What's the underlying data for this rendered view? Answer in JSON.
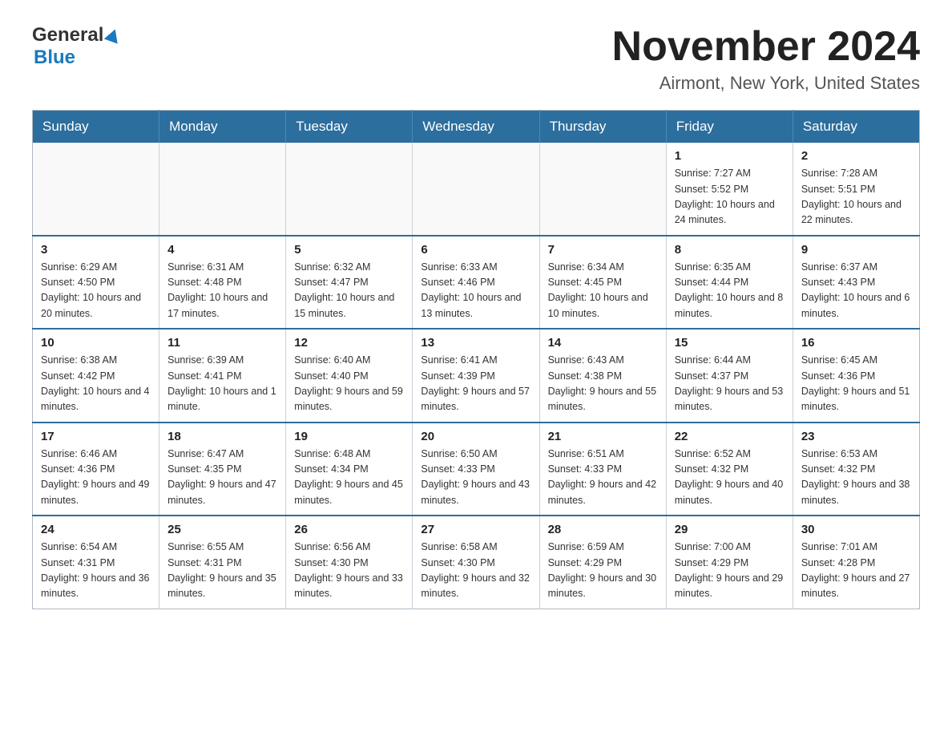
{
  "header": {
    "logo_line1": "General",
    "logo_line2": "Blue",
    "month_title": "November 2024",
    "location": "Airmont, New York, United States"
  },
  "days_of_week": [
    "Sunday",
    "Monday",
    "Tuesday",
    "Wednesday",
    "Thursday",
    "Friday",
    "Saturday"
  ],
  "weeks": [
    [
      {
        "day": "",
        "info": ""
      },
      {
        "day": "",
        "info": ""
      },
      {
        "day": "",
        "info": ""
      },
      {
        "day": "",
        "info": ""
      },
      {
        "day": "",
        "info": ""
      },
      {
        "day": "1",
        "info": "Sunrise: 7:27 AM\nSunset: 5:52 PM\nDaylight: 10 hours and 24 minutes."
      },
      {
        "day": "2",
        "info": "Sunrise: 7:28 AM\nSunset: 5:51 PM\nDaylight: 10 hours and 22 minutes."
      }
    ],
    [
      {
        "day": "3",
        "info": "Sunrise: 6:29 AM\nSunset: 4:50 PM\nDaylight: 10 hours and 20 minutes."
      },
      {
        "day": "4",
        "info": "Sunrise: 6:31 AM\nSunset: 4:48 PM\nDaylight: 10 hours and 17 minutes."
      },
      {
        "day": "5",
        "info": "Sunrise: 6:32 AM\nSunset: 4:47 PM\nDaylight: 10 hours and 15 minutes."
      },
      {
        "day": "6",
        "info": "Sunrise: 6:33 AM\nSunset: 4:46 PM\nDaylight: 10 hours and 13 minutes."
      },
      {
        "day": "7",
        "info": "Sunrise: 6:34 AM\nSunset: 4:45 PM\nDaylight: 10 hours and 10 minutes."
      },
      {
        "day": "8",
        "info": "Sunrise: 6:35 AM\nSunset: 4:44 PM\nDaylight: 10 hours and 8 minutes."
      },
      {
        "day": "9",
        "info": "Sunrise: 6:37 AM\nSunset: 4:43 PM\nDaylight: 10 hours and 6 minutes."
      }
    ],
    [
      {
        "day": "10",
        "info": "Sunrise: 6:38 AM\nSunset: 4:42 PM\nDaylight: 10 hours and 4 minutes."
      },
      {
        "day": "11",
        "info": "Sunrise: 6:39 AM\nSunset: 4:41 PM\nDaylight: 10 hours and 1 minute."
      },
      {
        "day": "12",
        "info": "Sunrise: 6:40 AM\nSunset: 4:40 PM\nDaylight: 9 hours and 59 minutes."
      },
      {
        "day": "13",
        "info": "Sunrise: 6:41 AM\nSunset: 4:39 PM\nDaylight: 9 hours and 57 minutes."
      },
      {
        "day": "14",
        "info": "Sunrise: 6:43 AM\nSunset: 4:38 PM\nDaylight: 9 hours and 55 minutes."
      },
      {
        "day": "15",
        "info": "Sunrise: 6:44 AM\nSunset: 4:37 PM\nDaylight: 9 hours and 53 minutes."
      },
      {
        "day": "16",
        "info": "Sunrise: 6:45 AM\nSunset: 4:36 PM\nDaylight: 9 hours and 51 minutes."
      }
    ],
    [
      {
        "day": "17",
        "info": "Sunrise: 6:46 AM\nSunset: 4:36 PM\nDaylight: 9 hours and 49 minutes."
      },
      {
        "day": "18",
        "info": "Sunrise: 6:47 AM\nSunset: 4:35 PM\nDaylight: 9 hours and 47 minutes."
      },
      {
        "day": "19",
        "info": "Sunrise: 6:48 AM\nSunset: 4:34 PM\nDaylight: 9 hours and 45 minutes."
      },
      {
        "day": "20",
        "info": "Sunrise: 6:50 AM\nSunset: 4:33 PM\nDaylight: 9 hours and 43 minutes."
      },
      {
        "day": "21",
        "info": "Sunrise: 6:51 AM\nSunset: 4:33 PM\nDaylight: 9 hours and 42 minutes."
      },
      {
        "day": "22",
        "info": "Sunrise: 6:52 AM\nSunset: 4:32 PM\nDaylight: 9 hours and 40 minutes."
      },
      {
        "day": "23",
        "info": "Sunrise: 6:53 AM\nSunset: 4:32 PM\nDaylight: 9 hours and 38 minutes."
      }
    ],
    [
      {
        "day": "24",
        "info": "Sunrise: 6:54 AM\nSunset: 4:31 PM\nDaylight: 9 hours and 36 minutes."
      },
      {
        "day": "25",
        "info": "Sunrise: 6:55 AM\nSunset: 4:31 PM\nDaylight: 9 hours and 35 minutes."
      },
      {
        "day": "26",
        "info": "Sunrise: 6:56 AM\nSunset: 4:30 PM\nDaylight: 9 hours and 33 minutes."
      },
      {
        "day": "27",
        "info": "Sunrise: 6:58 AM\nSunset: 4:30 PM\nDaylight: 9 hours and 32 minutes."
      },
      {
        "day": "28",
        "info": "Sunrise: 6:59 AM\nSunset: 4:29 PM\nDaylight: 9 hours and 30 minutes."
      },
      {
        "day": "29",
        "info": "Sunrise: 7:00 AM\nSunset: 4:29 PM\nDaylight: 9 hours and 29 minutes."
      },
      {
        "day": "30",
        "info": "Sunrise: 7:01 AM\nSunset: 4:28 PM\nDaylight: 9 hours and 27 minutes."
      }
    ]
  ]
}
